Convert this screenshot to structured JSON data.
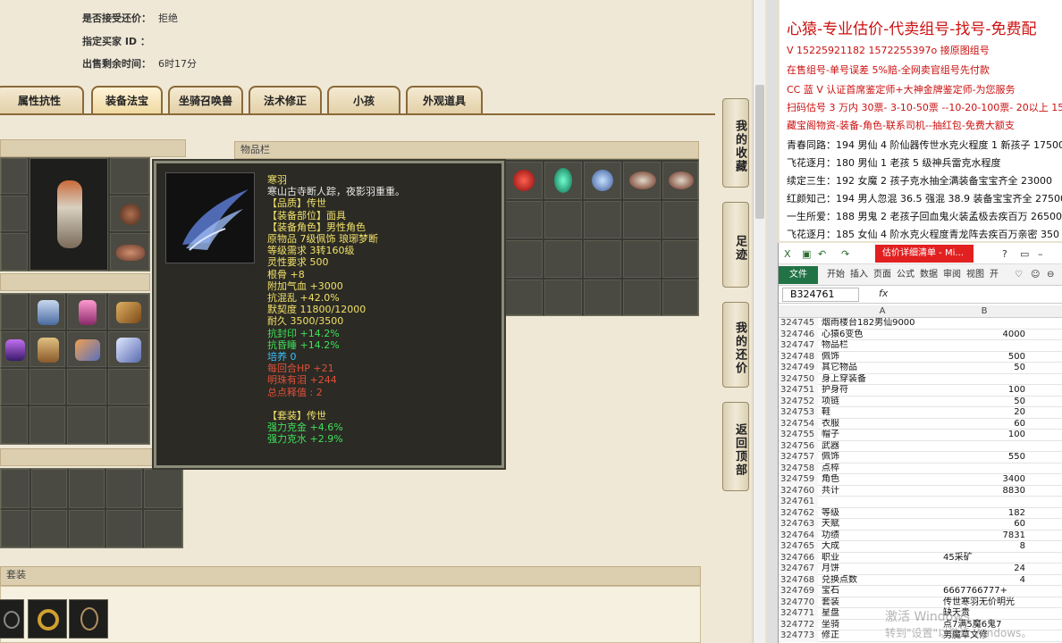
{
  "sale_info": {
    "accept_counter_label": "是否接受还价：",
    "accept_counter_value": "拒绝",
    "buyer_id_label": "指定买家 ID ：",
    "buyer_id_value": "",
    "time_left_label": "出售剩余时间：",
    "time_left_value": "6时17分"
  },
  "tabs": [
    "属性抗性",
    "装备法宝",
    "坐骑召唤兽",
    "法术修正",
    "小孩",
    "外观道具"
  ],
  "active_tab": "装备法宝",
  "panels": {
    "inventory_title": "物品栏",
    "suit_title": "套装"
  },
  "side_buttons": [
    "我的收藏",
    "足迹",
    "我的还价",
    "返回顶部"
  ],
  "tooltip": {
    "name": "寒羽",
    "desc": "寒山古寺断人踪，夜影羽重重。",
    "lines": [
      {
        "text": "【品质】传世",
        "color": "yel"
      },
      {
        "text": "【装备部位】面具",
        "color": "yel"
      },
      {
        "text": "【装备角色】男性角色",
        "color": "yel"
      },
      {
        "text": "原物品 7级佩饰 琅琊梦断",
        "color": "yel"
      },
      {
        "text": "等级需求 3转160级",
        "color": "yel"
      },
      {
        "text": "灵性要求 500",
        "color": "yel"
      },
      {
        "text": "根骨 +8",
        "color": "yel"
      },
      {
        "text": "附加气血 +3000",
        "color": "yel"
      },
      {
        "text": "抗混乱 +42.0%",
        "color": "yel"
      },
      {
        "text": "默契度 11800/12000",
        "color": "yel"
      },
      {
        "text": "耐久 3500/3500",
        "color": "yel"
      },
      {
        "text": "抗封印 +14.2%",
        "color": "grn"
      },
      {
        "text": "抗昏睡 +14.2%",
        "color": "grn"
      },
      {
        "text": "培养 0",
        "color": "cyn"
      },
      {
        "text": "每回合HP +21",
        "color": "red"
      },
      {
        "text": "明珠有泪 +244",
        "color": "red"
      },
      {
        "text": "总点释值 : 2",
        "color": "red"
      },
      {
        "text": "",
        "color": "yel"
      },
      {
        "text": "【套装】传世",
        "color": "yel"
      },
      {
        "text": "强力克金 +4.6%",
        "color": "grn"
      },
      {
        "text": "强力克水 +2.9%",
        "color": "grn"
      }
    ]
  },
  "ads": [
    {
      "text": "心猿-专业估价-代卖组号-找号-免费配",
      "style": "big"
    },
    {
      "text": "V 15225921182   1572255397o  接原图组号",
      "style": "red"
    },
    {
      "text": "在售组号-单号误差 5%赔-全网卖官组号先付款",
      "style": "red"
    },
    {
      "text": "CC 蓝 V 认证首席鉴定师+大神金牌鉴定师-为您服务",
      "style": "red"
    },
    {
      "text": "扫码估号 3 万内 30票- 3-10-50票 --10-20-100票- 20以上 150",
      "style": "red"
    },
    {
      "text": "藏宝阁物资-装备-角色-联系司机--抽红包-免费大额支",
      "style": "red"
    },
    {
      "text": "青春同路：194 男仙 4 阶仙器传世水克火程度 1 新孩子 17500",
      "style": "blk"
    },
    {
      "text": "飞花逐月：180 男仙 1 老孩 5 级神兵雷克水程度",
      "style": "blk"
    },
    {
      "text": "续定三生：192 女魔 2 孩子克水抽全满装备宝宝齐全 23000",
      "style": "blk"
    },
    {
      "text": "红颜知己：194 男人忽混 36.5 强混 38.9 装备宝宝齐全 27500",
      "style": "blk"
    },
    {
      "text": "一生所爱：188 男鬼 2 老孩子回血鬼火装孟极去疾百万 26500",
      "style": "blk"
    },
    {
      "text": "飞花逐月：185 女仙 4 阶水克火程度青龙阵去疾百万亲密 350",
      "style": "blk"
    }
  ],
  "excel": {
    "doc_title": "估价详细清单 - Mi...",
    "ribbon_tabs": [
      "文件",
      "开始",
      "插入",
      "页面",
      "公式",
      "数据",
      "审阅",
      "视图",
      "开"
    ],
    "name_box": "B324761",
    "fx": "fx",
    "col_headers": [
      "A",
      "B"
    ],
    "rows": [
      {
        "n": "324745",
        "a": "烟雨楼台182男仙9000",
        "b": ""
      },
      {
        "n": "324746",
        "a": "心猿6变色",
        "b": "4000"
      },
      {
        "n": "324747",
        "a": "物品栏",
        "b": ""
      },
      {
        "n": "324748",
        "a": "佩饰",
        "b": "500"
      },
      {
        "n": "324749",
        "a": "其它物品",
        "b": "50"
      },
      {
        "n": "324750",
        "a": "身上穿装备",
        "b": ""
      },
      {
        "n": "324751",
        "a": "护身符",
        "b": "100"
      },
      {
        "n": "324752",
        "a": "项链",
        "b": "50"
      },
      {
        "n": "324753",
        "a": "鞋",
        "b": "20"
      },
      {
        "n": "324754",
        "a": "衣服",
        "b": "60"
      },
      {
        "n": "324755",
        "a": "帽子",
        "b": "100"
      },
      {
        "n": "324756",
        "a": "武器",
        "b": ""
      },
      {
        "n": "324757",
        "a": "佩饰",
        "b": "550"
      },
      {
        "n": "324758",
        "a": "点椊",
        "b": ""
      },
      {
        "n": "324759",
        "a": "角色",
        "b": "3400"
      },
      {
        "n": "324760",
        "a": "共计",
        "b": "8830"
      },
      {
        "n": "324761",
        "a": "",
        "b": ""
      },
      {
        "n": "324762",
        "a": "等级",
        "b": "182"
      },
      {
        "n": "324763",
        "a": "天赋",
        "b": "60"
      },
      {
        "n": "324764",
        "a": "功绩",
        "b": "7831"
      },
      {
        "n": "324765",
        "a": "大成",
        "b": "8"
      },
      {
        "n": "324766",
        "a": "职业",
        "b": "45采矿",
        "text": true
      },
      {
        "n": "324767",
        "a": "月饼",
        "b": "24"
      },
      {
        "n": "324768",
        "a": "兑换点数",
        "b": "4"
      },
      {
        "n": "324769",
        "a": "宝石",
        "b": "6667766777+",
        "text": true
      },
      {
        "n": "324770",
        "a": "套装",
        "b": "传世寒羽无价明光",
        "text": true
      },
      {
        "n": "324771",
        "a": "星盘",
        "b": "缺天贵",
        "text": true
      },
      {
        "n": "324772",
        "a": "坐骑",
        "b": "点7满5魔6鬼7",
        "text": true
      },
      {
        "n": "324773",
        "a": "修正",
        "b": "男魔草文修",
        "text": true
      }
    ]
  },
  "watermark": {
    "line1": "激活 Windows",
    "line2": "转到\"设置\"以激活 Windows。"
  },
  "colors": {
    "excel_green": "#217346",
    "ad_red": "#cc1010",
    "tooltip_bg": "#2b2a24",
    "item_yellow": "#f1e16a"
  }
}
